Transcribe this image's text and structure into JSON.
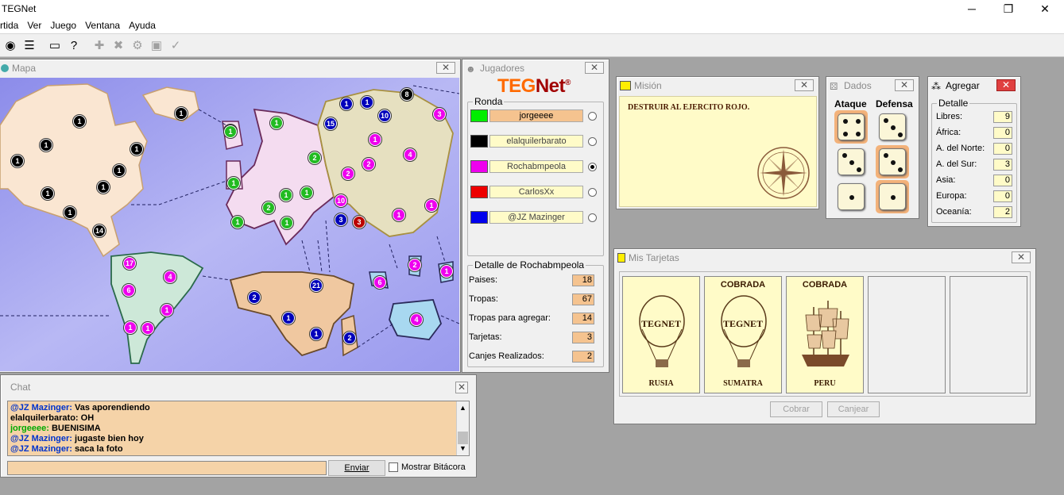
{
  "app": {
    "title": "TEGNet",
    "menu": [
      "rtida",
      "Ver",
      "Juego",
      "Ventana",
      "Ayuda"
    ]
  },
  "toolbar": {
    "buttons": [
      {
        "icon": "globe-icon",
        "glyph": "◉"
      },
      {
        "icon": "list-icon",
        "glyph": "☰"
      },
      {
        "icon": "message-icon",
        "glyph": "▭"
      },
      {
        "icon": "help-card-icon",
        "glyph": "?"
      },
      {
        "icon": "add-icon",
        "glyph": "✚"
      },
      {
        "icon": "attack-icon",
        "glyph": "✖"
      },
      {
        "icon": "regroup-icon",
        "glyph": "⚙"
      },
      {
        "icon": "cards-icon",
        "glyph": "▣"
      },
      {
        "icon": "end-turn-icon",
        "glyph": "✓"
      }
    ]
  },
  "mapa": {
    "title": "Mapa",
    "armies": [
      {
        "n": "1",
        "c": "#000000"
      },
      {
        "n": "1",
        "c": "#000000"
      },
      {
        "n": "1",
        "c": "#000000"
      },
      {
        "n": "1",
        "c": "#000000"
      },
      {
        "n": "1",
        "c": "#000000"
      },
      {
        "n": "1",
        "c": "#000000"
      },
      {
        "n": "1",
        "c": "#000000"
      },
      {
        "n": "1",
        "c": "#000000"
      },
      {
        "n": "14",
        "c": "#000000"
      },
      {
        "n": "1",
        "c": "#000000"
      },
      {
        "n": "8",
        "c": "#000000"
      },
      {
        "n": "17",
        "c": "#ee00ee"
      },
      {
        "n": "4",
        "c": "#ee00ee"
      },
      {
        "n": "6",
        "c": "#ee00ee"
      },
      {
        "n": "1",
        "c": "#ee00ee"
      },
      {
        "n": "1",
        "c": "#ee00ee"
      },
      {
        "n": "1",
        "c": "#ee00ee"
      },
      {
        "n": "1",
        "c": "#22bb22"
      },
      {
        "n": "1",
        "c": "#22bb22"
      },
      {
        "n": "2",
        "c": "#22bb22"
      },
      {
        "n": "1",
        "c": "#22bb22"
      },
      {
        "n": "1",
        "c": "#22bb22"
      },
      {
        "n": "1",
        "c": "#22bb22"
      },
      {
        "n": "2",
        "c": "#22bb22"
      },
      {
        "n": "1",
        "c": "#22bb22"
      },
      {
        "n": "1",
        "c": "#22bb22"
      },
      {
        "n": "1",
        "c": "#22bb22"
      },
      {
        "n": "1",
        "c": "#0000bb"
      },
      {
        "n": "1",
        "c": "#0000bb"
      },
      {
        "n": "15",
        "c": "#0000bb"
      },
      {
        "n": "10",
        "c": "#0000bb"
      },
      {
        "n": "3",
        "c": "#0000bb"
      },
      {
        "n": "2",
        "c": "#0000bb"
      },
      {
        "n": "21",
        "c": "#0000bb"
      },
      {
        "n": "1",
        "c": "#0000bb"
      },
      {
        "n": "1",
        "c": "#0000bb"
      },
      {
        "n": "2",
        "c": "#0000bb"
      },
      {
        "n": "3",
        "c": "#ee00ee"
      },
      {
        "n": "1",
        "c": "#ee00ee"
      },
      {
        "n": "2",
        "c": "#ee00ee"
      },
      {
        "n": "2",
        "c": "#ee00ee"
      },
      {
        "n": "4",
        "c": "#ee00ee"
      },
      {
        "n": "10",
        "c": "#ee00ee"
      },
      {
        "n": "1",
        "c": "#ee00ee"
      },
      {
        "n": "1",
        "c": "#ee00ee"
      },
      {
        "n": "6",
        "c": "#ee00ee"
      },
      {
        "n": "2",
        "c": "#ee00ee"
      },
      {
        "n": "1",
        "c": "#ee00ee"
      },
      {
        "n": "4",
        "c": "#ee00ee"
      },
      {
        "n": "3",
        "c": "#bb0000"
      }
    ]
  },
  "jugadores": {
    "title": "Jugadores",
    "logo_a": "TEG",
    "logo_b": "Net",
    "logo_reg": "®",
    "ronda_label": "Ronda",
    "players": [
      {
        "name": "jorgeeee",
        "color": "#00ee00",
        "active": true,
        "radio": false
      },
      {
        "name": "elalquilerbarato",
        "color": "#000000",
        "active": false,
        "radio": false
      },
      {
        "name": "Rochabmpeola",
        "color": "#ee00ee",
        "active": false,
        "radio": true
      },
      {
        "name": "CarlosXx",
        "color": "#ee0000",
        "active": false,
        "radio": false
      },
      {
        "name": "@JZ Mazinger",
        "color": "#0000ee",
        "active": false,
        "radio": false
      }
    ],
    "detalle_label": "Detalle de Rochabmpeola",
    "detalle": [
      {
        "label": "Paises:",
        "value": "18"
      },
      {
        "label": "Tropas:",
        "value": "67"
      },
      {
        "label": "Tropas para agregar:",
        "value": "14"
      },
      {
        "label": "Tarjetas:",
        "value": "3"
      },
      {
        "label": "Canjes Realizados:",
        "value": "2"
      }
    ]
  },
  "mision": {
    "title": "Misión",
    "text": "DESTRUIR AL EJERCITO ROJO."
  },
  "dados": {
    "title": "Dados",
    "ataque_label": "Ataque",
    "defensa_label": "Defensa",
    "ataque": [
      4,
      3,
      1
    ],
    "defensa": [
      3,
      3,
      1
    ],
    "ataque_highlight": [
      true,
      false,
      false
    ],
    "defensa_highlight": [
      false,
      true,
      true
    ]
  },
  "agregar": {
    "title": "Agregar",
    "detalle_label": "Detalle",
    "rows": [
      {
        "label": "Libres:",
        "value": "9"
      },
      {
        "label": "África:",
        "value": "0"
      },
      {
        "label": "A. del Norte:",
        "value": "0"
      },
      {
        "label": "A. del Sur:",
        "value": "3"
      },
      {
        "label": "Asia:",
        "value": "0"
      },
      {
        "label": "Europa:",
        "value": "0"
      },
      {
        "label": "Oceanía:",
        "value": "2"
      }
    ]
  },
  "tarjetas": {
    "title": "Mis Tarjetas",
    "cards": [
      {
        "top": "",
        "name": "RUSIA",
        "art": "balloon",
        "art_text": "TEGNET"
      },
      {
        "top": "COBRADA",
        "name": "SUMATRA",
        "art": "balloon",
        "art_text": "TEGNET"
      },
      {
        "top": "COBRADA",
        "name": "PERU",
        "art": "ship",
        "art_text": ""
      },
      {
        "top": "",
        "name": "",
        "art": "",
        "art_text": ""
      },
      {
        "top": "",
        "name": "",
        "art": "",
        "art_text": ""
      }
    ],
    "cobrar_label": "Cobrar",
    "canjear_label": "Canjear"
  },
  "chat": {
    "title": "Chat",
    "lines": [
      {
        "who": "@JZ Mazinger:",
        "msg": " Vas aporendiendo",
        "kind": "a"
      },
      {
        "who": "elalquilerbarato:",
        "msg": " OH",
        "kind": "b"
      },
      {
        "who": "jorgeeee:",
        "msg": " BUENISIMA",
        "kind": "g"
      },
      {
        "who": "@JZ Mazinger:",
        "msg": " jugaste bien hoy",
        "kind": "a"
      },
      {
        "who": "@JZ Mazinger:",
        "msg": " saca la foto",
        "kind": "a"
      }
    ],
    "input_value": "",
    "enviar_label": "Enviar",
    "bitacora_label": "Mostrar Bitácora"
  }
}
